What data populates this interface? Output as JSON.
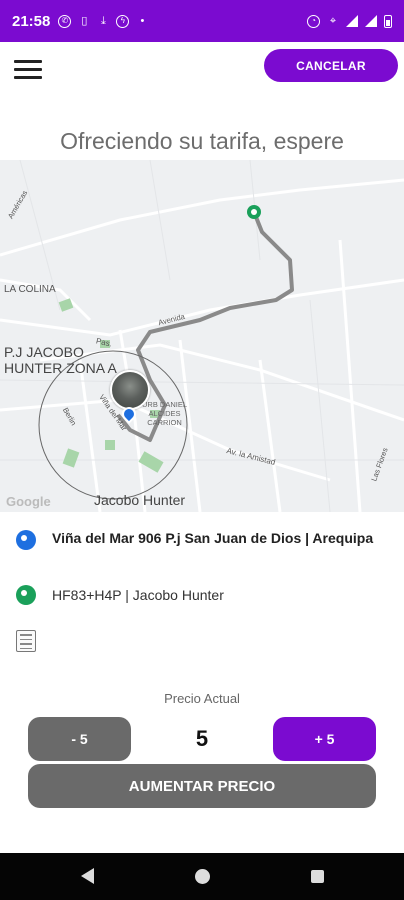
{
  "status_bar": {
    "time": "21:58",
    "left_icons": [
      "whatsapp-icon",
      "sim-icon",
      "download-icon",
      "messenger-icon",
      "dot-icon"
    ],
    "right_icons": [
      "alarm-icon",
      "location-icon",
      "signal-icon",
      "battery-icon"
    ]
  },
  "header": {
    "cancel_label": "CANCELAR",
    "title": "Ofreciendo su tarifa, espere"
  },
  "map": {
    "labels": {
      "la_colina": "LA COLINA",
      "pj_jacobo": "P.J JACOBO",
      "hunter_zona": "HUNTER ZONA A",
      "urb_daniel_1": "URB DANIEL",
      "urb_daniel_2": "ALCIDES",
      "urb_daniel_3": "CARRION",
      "av_amistad": "Av. la Amistad",
      "jacobo_hunter": "Jacobo Hunter",
      "avenida": "Avenida",
      "pasaje": "Pas.",
      "vina": "Viña del Mar",
      "berlin": "Berlin",
      "las_flores": "Las Flores",
      "americas": "Américas",
      "google": "Google"
    },
    "colors": {
      "route": "#8a8a8a",
      "origin_pin": "#1e6fe0",
      "destination_pin": "#1aa05a"
    }
  },
  "trip": {
    "origin": "Viña del Mar 906 P.j San Juan de Dios | Arequipa",
    "destination": "HF83+H4P  | Jacobo Hunter"
  },
  "price": {
    "label": "Precio Actual",
    "value": "5",
    "minus_label": "- 5",
    "plus_label": "+ 5",
    "raise_label": "AUMENTAR PRECIO"
  },
  "theme": {
    "accent": "#7b0bd0",
    "button_gray": "#6a6a6a"
  }
}
